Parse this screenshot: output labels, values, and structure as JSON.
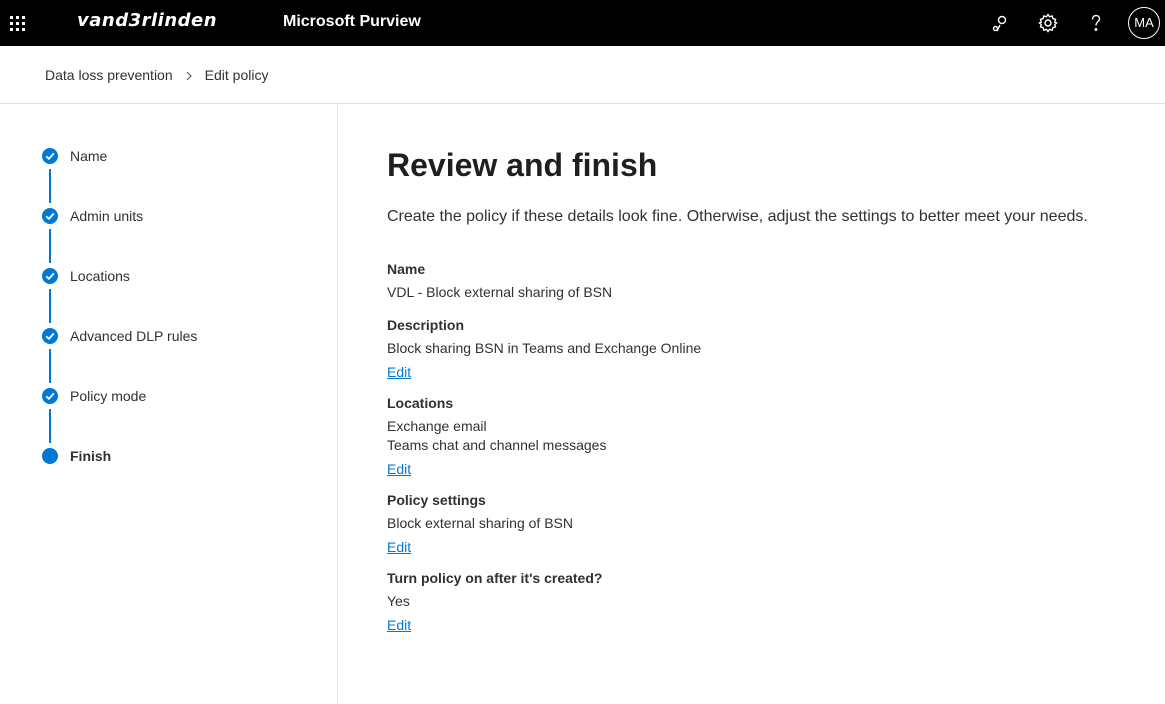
{
  "topbar": {
    "brand": "vand3rlinden",
    "product": "Microsoft Purview",
    "avatar_initials": "MA",
    "icons": [
      "waffle-icon",
      "connections-icon",
      "settings-icon",
      "help-icon"
    ]
  },
  "breadcrumb": {
    "items": [
      "Data loss prevention",
      "Edit policy"
    ]
  },
  "stepper": {
    "steps": [
      {
        "label": "Name",
        "status": "completed"
      },
      {
        "label": "Admin units",
        "status": "completed"
      },
      {
        "label": "Locations",
        "status": "completed"
      },
      {
        "label": "Advanced DLP rules",
        "status": "completed"
      },
      {
        "label": "Policy mode",
        "status": "completed"
      },
      {
        "label": "Finish",
        "status": "current"
      }
    ]
  },
  "main": {
    "title": "Review and finish",
    "intro": "Create the policy if these details look fine. Otherwise, adjust the settings to better meet your needs.",
    "sections": [
      {
        "title": "Name",
        "values": [
          "VDL - Block external sharing of BSN"
        ]
      },
      {
        "title": "Description",
        "values": [
          "Block sharing BSN in Teams and Exchange Online"
        ],
        "edit": "Edit"
      },
      {
        "title": "Locations",
        "values": [
          "Exchange email",
          "Teams chat and channel messages"
        ],
        "edit": "Edit"
      },
      {
        "title": "Policy settings",
        "values": [
          "Block external sharing of BSN"
        ],
        "edit": "Edit"
      },
      {
        "title": "Turn policy on after it's created?",
        "values": [
          "Yes"
        ],
        "edit": "Edit"
      }
    ]
  },
  "colors": {
    "topbar_bg": "#000000",
    "accent": "#0078d4",
    "text": "#323130",
    "divider": "#e1dfdd"
  }
}
